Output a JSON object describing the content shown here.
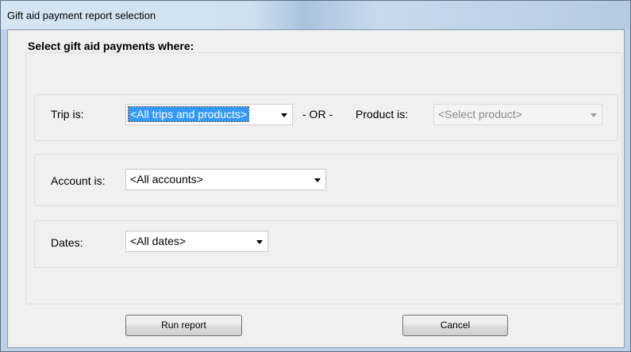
{
  "window": {
    "title": "Gift aid payment report selection"
  },
  "form": {
    "heading": "Select gift aid payments where:",
    "trip": {
      "label": "Trip is:",
      "value": "<All trips and products>"
    },
    "or_separator": "- OR -",
    "product": {
      "label": "Product is:",
      "value": "<Select product>"
    },
    "account": {
      "label": "Account is:",
      "value": "<All accounts>"
    },
    "dates": {
      "label": "Dates:",
      "value": "<All dates>"
    }
  },
  "buttons": {
    "run_report": "Run report",
    "cancel": "Cancel"
  }
}
